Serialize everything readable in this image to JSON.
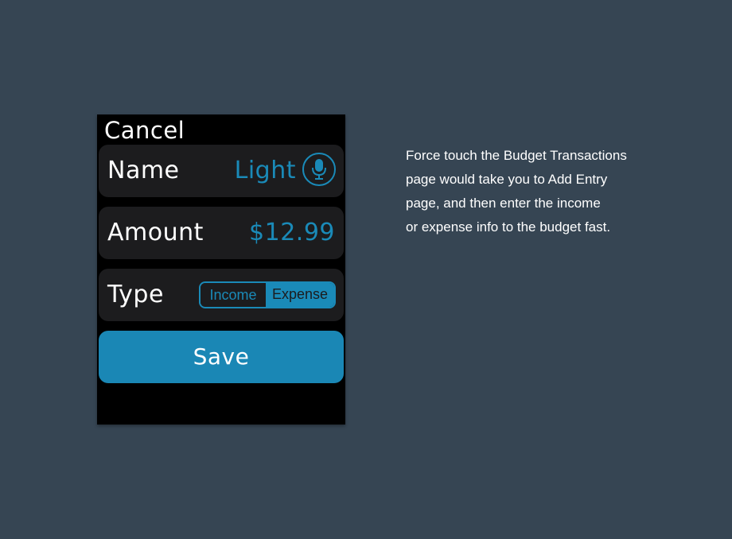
{
  "watch": {
    "cancel_label": "Cancel",
    "name": {
      "label": "Name",
      "value": "Light",
      "mic_icon": "microphone-icon"
    },
    "amount": {
      "label": "Amount",
      "value": "$12.99"
    },
    "type": {
      "label": "Type",
      "options": [
        "Income",
        "Expense"
      ],
      "selected": "Expense"
    },
    "save_label": "Save"
  },
  "description": {
    "lines": [
      "Force touch the Budget Transactions",
      "page would take you to Add Entry",
      "page, and then enter the income",
      "or expense info to the budget fast."
    ]
  },
  "colors": {
    "background": "#364553",
    "screen": "#000000",
    "row": "#1c1c1e",
    "accent": "#1a8ab8",
    "save_button": "#1a87b5",
    "text": "#ffffff"
  }
}
